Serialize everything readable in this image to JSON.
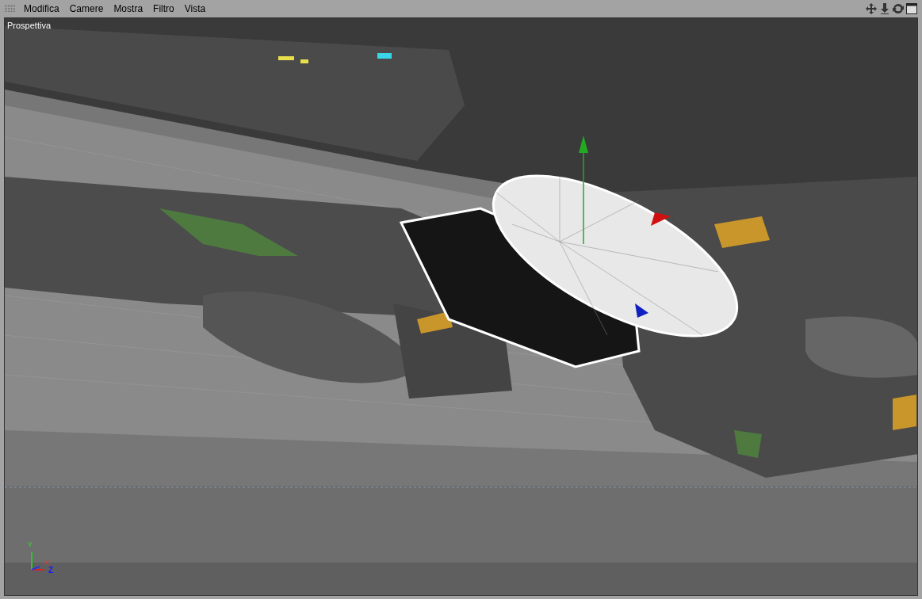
{
  "menu": [
    "Modifica",
    "Camere",
    "Mostra",
    "Filtro",
    "Vista"
  ],
  "viewport": {
    "label": "Prospettiva",
    "axis_labels": [
      "Y",
      "X",
      "Z"
    ]
  }
}
